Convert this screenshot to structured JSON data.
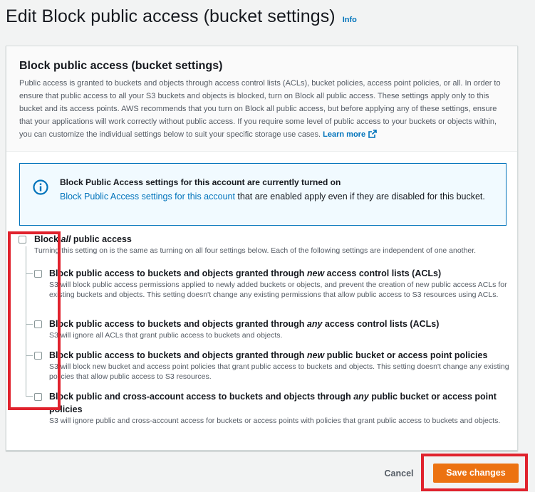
{
  "page": {
    "title": "Edit Block public access (bucket settings)",
    "info_link": "Info"
  },
  "panel": {
    "title": "Block public access (bucket settings)",
    "description": "Public access is granted to buckets and objects through access control lists (ACLs), bucket policies, access point policies, or all. In order to ensure that public access to all your S3 buckets and objects is blocked, turn on Block all public access. These settings apply only to this bucket and its access points. AWS recommends that you turn on Block all public access, but before applying any of these settings, ensure that your applications will work correctly without public access. If you require some level of public access to your buckets or objects within, you can customize the individual settings below to suit your specific storage use cases.",
    "learn_more": "Learn more"
  },
  "alert": {
    "title": "Block Public Access settings for this account are currently turned on",
    "link_text": "Block Public Access settings for this account",
    "body_rest": " that are enabled apply even if they are disabled for this bucket."
  },
  "block_all": {
    "label_pre": "Block ",
    "label_em": "all",
    "label_post": " public access",
    "description": "Turning this setting on is the same as turning on all four settings below. Each of the following settings are independent of one another.",
    "checked": false
  },
  "options": [
    {
      "label_pre": "Block public access to buckets and objects granted through ",
      "label_em": "new",
      "label_post": " access control lists (ACLs)",
      "description": "S3 will block public access permissions applied to newly added buckets or objects, and prevent the creation of new public access ACLs for existing buckets and objects. This setting doesn't change any existing permissions that allow public access to S3 resources using ACLs.",
      "checked": false
    },
    {
      "label_pre": "Block public access to buckets and objects granted through ",
      "label_em": "any",
      "label_post": " access control lists (ACLs)",
      "description": "S3 will ignore all ACLs that grant public access to buckets and objects.",
      "checked": false
    },
    {
      "label_pre": "Block public access to buckets and objects granted through ",
      "label_em": "new",
      "label_post": " public bucket or access point policies",
      "description": "S3 will block new bucket and access point policies that grant public access to buckets and objects. This setting doesn't change any existing policies that allow public access to S3 resources.",
      "checked": false
    },
    {
      "label_pre": "Block public and cross-account access to buckets and objects through ",
      "label_em": "any",
      "label_post": " public bucket or access point policies",
      "description": "S3 will ignore public and cross-account access for buckets or access points with policies that grant public access to buckets and objects.",
      "checked": false
    }
  ],
  "footer": {
    "cancel_label": "Cancel",
    "save_label": "Save changes"
  },
  "colors": {
    "accent": "#0073bb",
    "primary_button": "#ec7211",
    "highlight": "#e0222d",
    "info_bg": "#f1faff"
  },
  "icons": {
    "info": "info-circle-icon",
    "external": "external-link-icon",
    "checkbox": "checkbox-icon"
  }
}
